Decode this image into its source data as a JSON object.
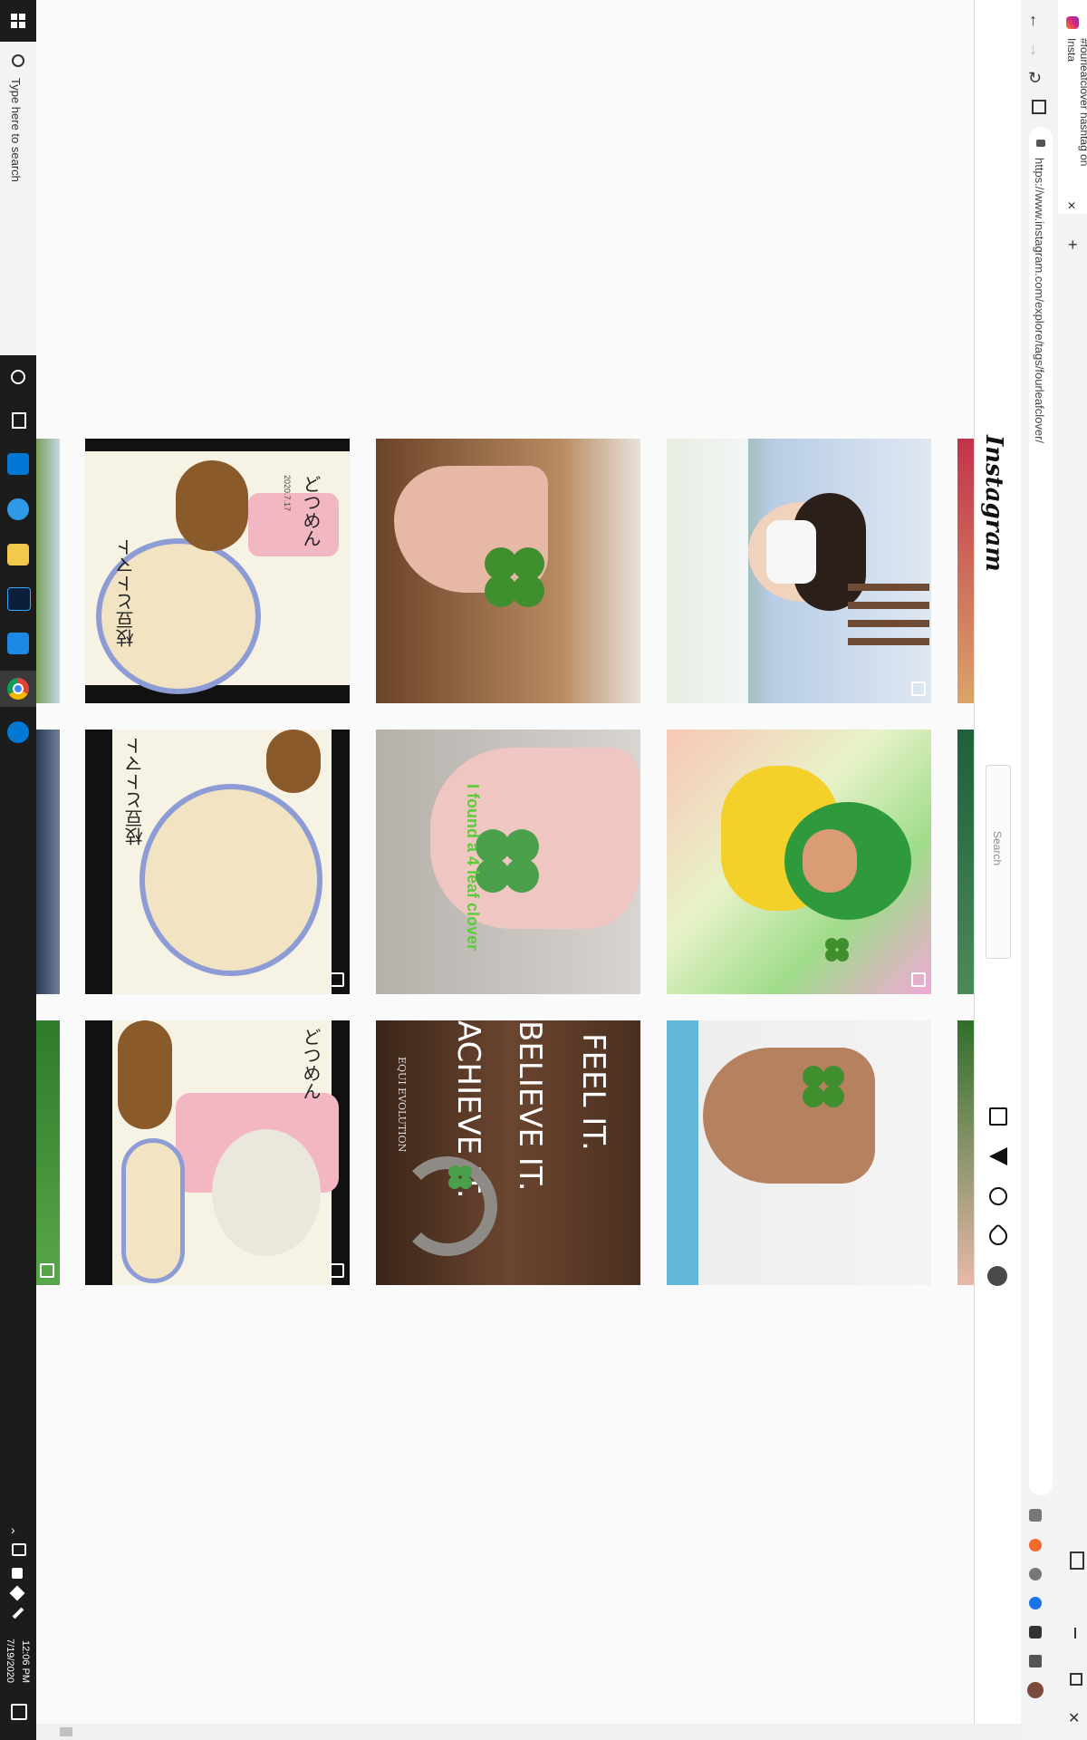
{
  "taskbar": {
    "search_placeholder": "Type here to search",
    "clock_time": "12:06 PM",
    "clock_date": "7/19/2020"
  },
  "browser": {
    "tab_title": "#fourleafclover hashtag on Insta",
    "url": "https://www.instagram.com/explore/tags/fourleafclover/"
  },
  "instagram": {
    "logo_text": "Instagram",
    "search_placeholder": "Search"
  },
  "posts": {
    "clover_note": "I found a 4 leaf clover",
    "motto_line1": "FEEL IT.",
    "motto_line2": "BELIEVE IT.",
    "motto_line3": "ACHIEVE IT.",
    "motto_brand": "EQUI EVOLUTION",
    "art_text_1": "どつめん",
    "art_text_2": "枝豆とトマト",
    "art_date": "2020.7.17"
  },
  "colors": {
    "taskbar_bg": "#1c1c1c",
    "ig_bg": "#fafafa",
    "clover_green": "#3f8f2f"
  }
}
